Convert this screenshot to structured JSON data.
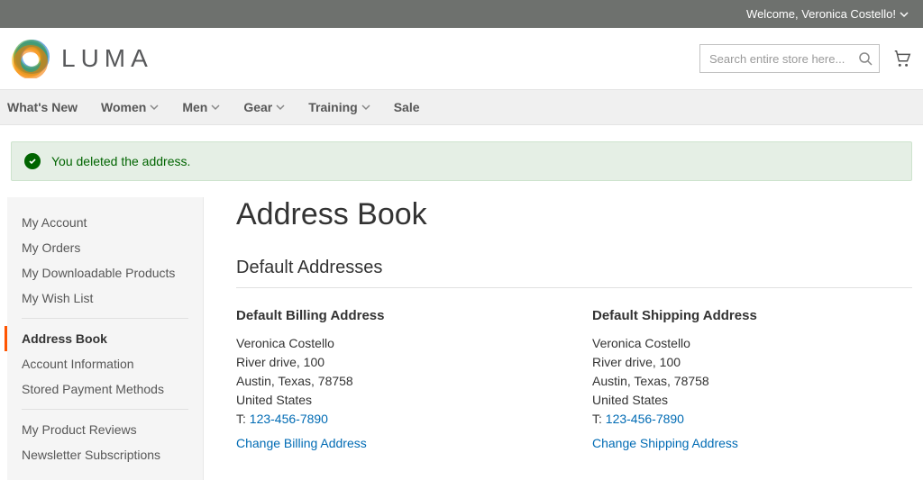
{
  "topbar": {
    "welcome": "Welcome, Veronica Costello!"
  },
  "logo": {
    "text": "LUMA"
  },
  "search": {
    "placeholder": "Search entire store here..."
  },
  "nav": {
    "items": [
      {
        "label": "What's New",
        "dropdown": false
      },
      {
        "label": "Women",
        "dropdown": true
      },
      {
        "label": "Men",
        "dropdown": true
      },
      {
        "label": "Gear",
        "dropdown": true
      },
      {
        "label": "Training",
        "dropdown": true
      },
      {
        "label": "Sale",
        "dropdown": false
      }
    ]
  },
  "message": {
    "text": "You deleted the address."
  },
  "sidebar": {
    "groups": [
      {
        "items": [
          {
            "label": "My Account"
          },
          {
            "label": "My Orders"
          },
          {
            "label": "My Downloadable Products"
          },
          {
            "label": "My Wish List"
          }
        ]
      },
      {
        "items": [
          {
            "label": "Address Book",
            "current": true
          },
          {
            "label": "Account Information"
          },
          {
            "label": "Stored Payment Methods"
          }
        ]
      },
      {
        "items": [
          {
            "label": "My Product Reviews"
          },
          {
            "label": "Newsletter Subscriptions"
          }
        ]
      }
    ]
  },
  "page": {
    "title": "Address Book",
    "section_title": "Default Addresses",
    "billing": {
      "title": "Default Billing Address",
      "name": "Veronica Costello",
      "street": "River drive, 100",
      "city_line": "Austin, Texas, 78758",
      "country": "United States",
      "tel_prefix": "T: ",
      "tel": "123-456-7890",
      "change": "Change Billing Address"
    },
    "shipping": {
      "title": "Default Shipping Address",
      "name": "Veronica Costello",
      "street": "River drive, 100",
      "city_line": "Austin, Texas, 78758",
      "country": "United States",
      "tel_prefix": "T: ",
      "tel": "123-456-7890",
      "change": "Change Shipping Address"
    }
  }
}
